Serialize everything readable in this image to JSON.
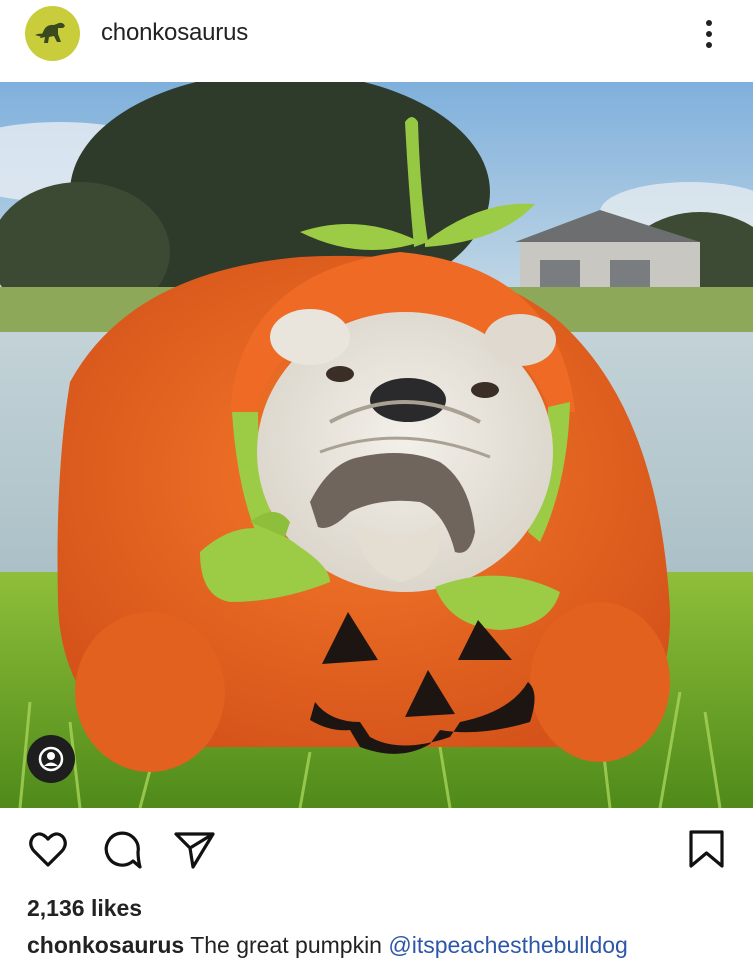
{
  "post": {
    "username": "chonkosaurus",
    "likes": "2,136 likes",
    "caption": {
      "username": "chonkosaurus",
      "text": "The great pumpkin",
      "mention": "@itspeachesthebulldog"
    }
  },
  "icons": {
    "avatar": "dinosaur-icon",
    "more": "more-options-icon",
    "tag": "user-tag-icon",
    "like": "heart-icon",
    "comment": "comment-icon",
    "share": "send-icon",
    "save": "bookmark-icon"
  },
  "colors": {
    "avatar_bg": "#c9cd3c",
    "mention": "#2d57a8",
    "costume": "#ef6a24"
  }
}
